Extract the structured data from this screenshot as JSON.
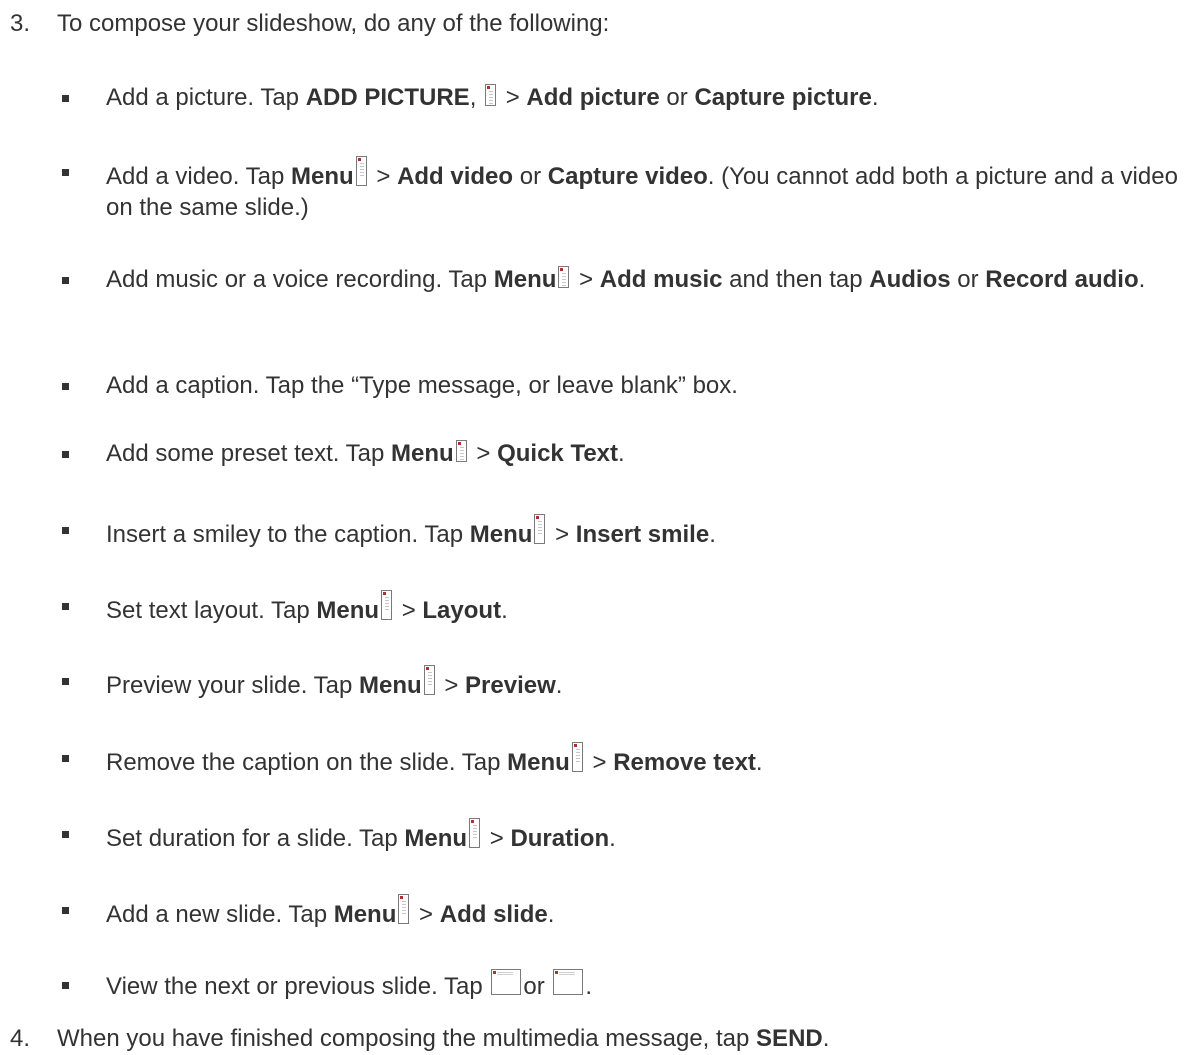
{
  "step3": {
    "number": "3.",
    "text": "To compose your slideshow, do any of the following:"
  },
  "items": [
    {
      "lead": "Add a picture. Tap ",
      "b1": "ADD PICTURE",
      "mid1": ", ",
      "icon": "menu-icon",
      "sep": " > ",
      "b2": "Add picture",
      "mid2": " or ",
      "b3": "Capture picture",
      "end": "."
    },
    {
      "lead": "Add a video. Tap ",
      "b1": "Menu",
      "icon": "menu-icon",
      "sep": " > ",
      "b2": "Add video",
      "mid2": " or ",
      "b3": "Capture video",
      "end": ". (You cannot add both a picture and a video on the same slide.)"
    },
    {
      "lead": "Add music or a voice recording. Tap ",
      "b1": "Menu",
      "icon": "menu-icon",
      "sep": " > ",
      "b2": "Add music",
      "mid2": " and then tap ",
      "b3": "Audios",
      "mid3": " or ",
      "b4": "Record audio",
      "end": "."
    },
    {
      "text": "Add a caption. Tap the “Type message, or leave blank” box."
    },
    {
      "lead": "Add some preset text. Tap ",
      "b1": "Menu",
      "icon": "menu-icon",
      "sep": " > ",
      "b2": "Quick Text",
      "end": "."
    },
    {
      "lead": "Insert a smiley to the caption. Tap ",
      "b1": "Menu",
      "icon": "menu-icon",
      "sep": " > ",
      "b2": "Insert smile",
      "end": "."
    },
    {
      "lead": "Set text layout. Tap ",
      "b1": "Menu",
      "icon": "menu-icon",
      "sep": " > ",
      "b2": "Layout",
      "end": "."
    },
    {
      "lead": "Preview your slide. Tap ",
      "b1": "Menu",
      "icon": "menu-icon",
      "sep": " > ",
      "b2": "Preview",
      "end": "."
    },
    {
      "lead": "Remove the caption on  the slide. Tap ",
      "b1": "Menu",
      "icon": "menu-icon",
      "sep": " > ",
      "b2": "Remove text",
      "end": "."
    },
    {
      "lead": "Set duration for a slide. Tap ",
      "b1": "Menu",
      "icon": "menu-icon",
      "sep": " > ",
      "b2": "Duration",
      "end": "."
    },
    {
      "lead": "Add a new slide. Tap ",
      "b1": "Menu",
      "icon": "menu-icon",
      "sep": " > ",
      "b2": "Add slide",
      "end": "."
    },
    {
      "lead": "View the next or previous slide. Tap ",
      "icon_next": "next-slide-icon",
      "mid": "or ",
      "icon_prev": "previous-slide-icon",
      "end": "."
    }
  ],
  "step4": {
    "number": "4.",
    "lead": "When you have finished composing the multimedia message, tap ",
    "b1": "SEND",
    "end": "."
  }
}
